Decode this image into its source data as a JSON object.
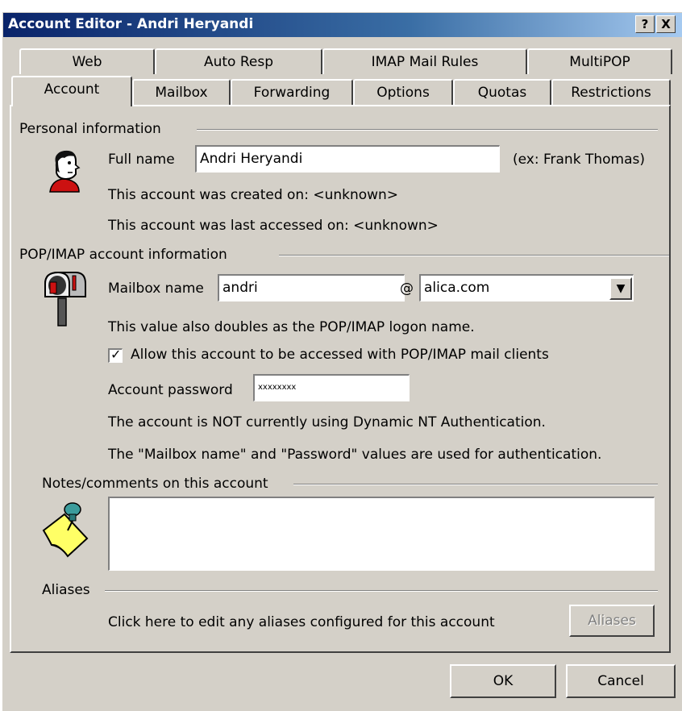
{
  "window": {
    "title": "Account Editor - Andri Heryandi",
    "help_label": "?",
    "close_label": "X"
  },
  "tabs": {
    "row1": [
      {
        "label": "Web"
      },
      {
        "label": "Auto Resp"
      },
      {
        "label": "IMAP Mail Rules"
      },
      {
        "label": "MultiPOP"
      }
    ],
    "row2": [
      {
        "label": "Account",
        "active": true
      },
      {
        "label": "Mailbox"
      },
      {
        "label": "Forwarding"
      },
      {
        "label": "Options"
      },
      {
        "label": "Quotas"
      },
      {
        "label": "Restrictions"
      }
    ]
  },
  "personal": {
    "group_label": "Personal information",
    "full_name_label": "Full name",
    "full_name_value": "Andri Heryandi",
    "example_hint": "(ex: Frank Thomas)",
    "created_text": "This account was created on: <unknown>",
    "accessed_text": "This account was last accessed on: <unknown>"
  },
  "pop_imap": {
    "group_label": "POP/IMAP account information",
    "mailbox_label": "Mailbox name",
    "mailbox_value": "andri",
    "at_sign": "@",
    "domain_value": "alica.com",
    "logon_note": "This value also doubles as the POP/IMAP logon name.",
    "allow_checkbox_label": "Allow this account to be accessed with POP/IMAP mail clients",
    "allow_checked": true,
    "password_label": "Account password",
    "password_value": "xxxxxxxx",
    "auth_note": "The account is NOT currently using Dynamic NT Authentication.",
    "values_note": "The \"Mailbox name\" and \"Password\" values are used for authentication."
  },
  "notes": {
    "group_label": "Notes/comments on this account",
    "value": ""
  },
  "aliases": {
    "group_label": "Aliases",
    "description": "Click here to edit any aliases configured for this account",
    "button_label": "Aliases"
  },
  "footer": {
    "ok_label": "OK",
    "cancel_label": "Cancel"
  },
  "icons": {
    "person": "person-icon",
    "mailbox": "mailbox-icon",
    "note": "sticky-note-icon",
    "dropdown": "chevron-down-icon",
    "checkmark": "checkmark-icon"
  },
  "colors": {
    "titlebar_start": "#0a246a",
    "titlebar_end": "#a6caf0",
    "dialog_face": "#d4d0c8"
  }
}
